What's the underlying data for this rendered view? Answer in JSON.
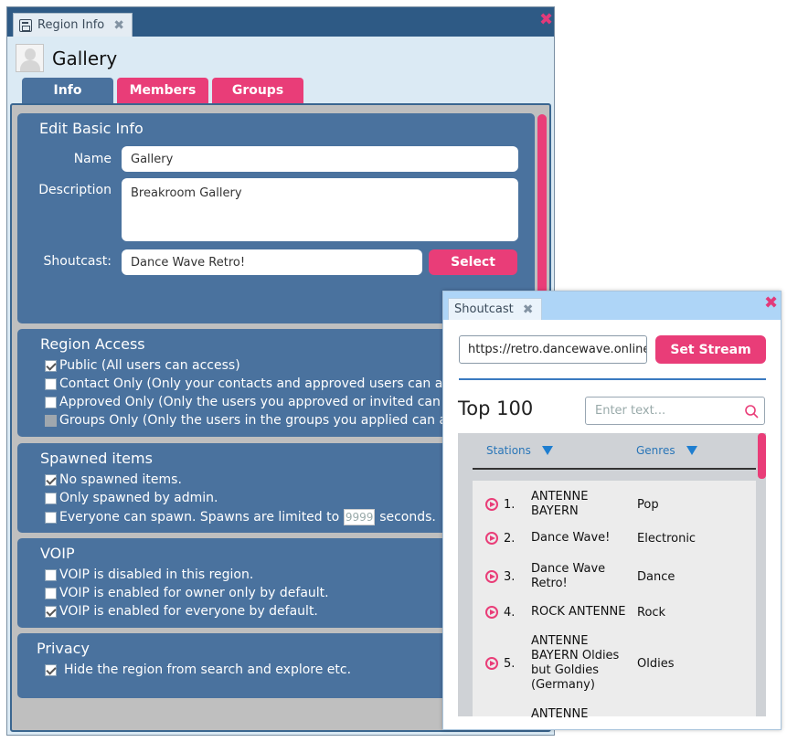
{
  "region_window": {
    "title": "Region Info",
    "title_close": "✖",
    "close": "✖",
    "page_title": "Gallery",
    "tabs": {
      "info": "Info",
      "members": "Members",
      "groups": "Groups"
    }
  },
  "edit_basic": {
    "title": "Edit Basic Info",
    "name_label": "Name",
    "name_value": "Gallery",
    "description_label": "Description",
    "description_value": "Breakroom Gallery",
    "shoutcast_label": "Shoutcast:",
    "shoutcast_value": "Dance Wave Retro!",
    "select_label": "Select"
  },
  "region_access": {
    "title": "Region Access",
    "options": [
      {
        "label": "Public (All users can access)",
        "checked": true
      },
      {
        "label": "Contact Only (Only your contacts and approved users can access)",
        "checked": false
      },
      {
        "label": "Approved Only (Only the users you approved or invited can access)",
        "checked": false
      },
      {
        "label": "Groups Only (Only the users in the groups you applied can access)",
        "checked": false,
        "disabled": true
      }
    ]
  },
  "spawned": {
    "title": "Spawned items",
    "opt1": "No spawned items.",
    "opt2": "Only spawned by admin.",
    "opt3_pre": "Everyone can spawn. Spawns are limited to",
    "opt3_value": "9999",
    "opt3_post": "seconds."
  },
  "voip": {
    "title": "VOIP",
    "opt1": "VOIP is disabled in this region.",
    "opt2": "VOIP is enabled for owner only by default.",
    "opt3": "VOIP is enabled for everyone by default."
  },
  "privacy": {
    "title": "Privacy",
    "opt1": "Hide the region from search and explore etc."
  },
  "shoutcast_window": {
    "title": "Shoutcast",
    "title_close": "✖",
    "close": "✖",
    "url_value": "https://retro.dancewave.online",
    "set_stream_label": "Set Stream",
    "top_title": "Top 100",
    "search_placeholder": "Enter text...",
    "col_stations": "Stations",
    "col_genres": "Genres",
    "rows": [
      {
        "rank": "1.",
        "station": "ANTENNE BAYERN",
        "genre": "Pop"
      },
      {
        "rank": "2.",
        "station": "Dance Wave!",
        "genre": "Electronic"
      },
      {
        "rank": "3.",
        "station": "Dance Wave Retro!",
        "genre": "Dance"
      },
      {
        "rank": "4.",
        "station": "ROCK ANTENNE",
        "genre": "Rock"
      },
      {
        "rank": "5.",
        "station": "ANTENNE BAYERN Oldies but Goldies (Germany)",
        "genre": "Oldies"
      },
      {
        "rank": "",
        "station": "ANTENNE",
        "genre": ""
      }
    ]
  },
  "colors": {
    "accent": "#e93d78",
    "panel": "#4a729e",
    "titlebar": "#2e5a85"
  }
}
